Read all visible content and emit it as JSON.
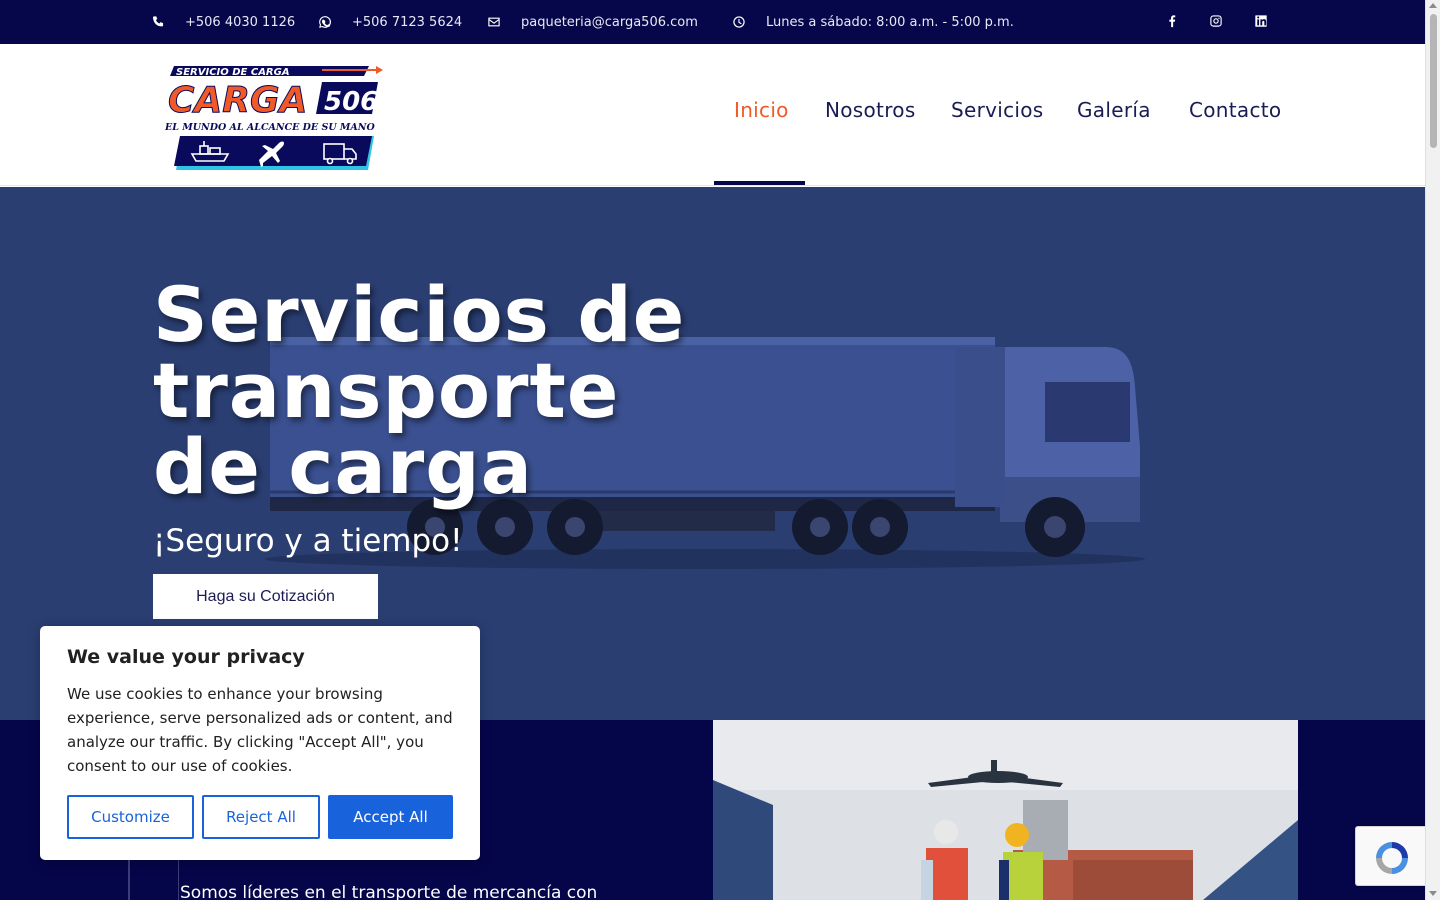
{
  "topbar": {
    "phone": "+506 4030 1126",
    "whatsapp": "+506 7123 5624",
    "email": "paqueteria@carga506.com",
    "hours": "Lunes a sábado: 8:00 a.m. - 5:00 p.m.",
    "social": [
      "facebook-icon",
      "instagram-icon",
      "linkedin-icon"
    ]
  },
  "logo": {
    "line1": "SERVICIO DE CARGA",
    "brand": "CARGA",
    "number": "506",
    "tagline": "EL MUNDO AL ALCANCE DE SU MANO"
  },
  "nav": {
    "items": [
      {
        "label": "Inicio",
        "active": true
      },
      {
        "label": "Nosotros"
      },
      {
        "label": "Servicios"
      },
      {
        "label": "Galería"
      },
      {
        "label": "Contacto"
      }
    ]
  },
  "hero": {
    "title_line1": "Servicios de",
    "title_line2": "transporte",
    "title_line3": "de carga",
    "subtitle": "¡Seguro y a tiempo!",
    "cta": "Haga su Cotización"
  },
  "about": {
    "text": "Somos líderes en el transporte de mercancía con"
  },
  "cookie": {
    "title": "We value your privacy",
    "body": "We use cookies to enhance your browsing experience, serve personalized ads or content, and analyze our traffic. By clicking \"Accept All\", you consent to our use of cookies.",
    "customize": "Customize",
    "reject": "Reject All",
    "accept": "Accept All"
  },
  "colors": {
    "navy": "#06064a",
    "accent": "#f05a28",
    "hero_bg": "#2a3e72",
    "cookie_blue": "#1863dc"
  }
}
